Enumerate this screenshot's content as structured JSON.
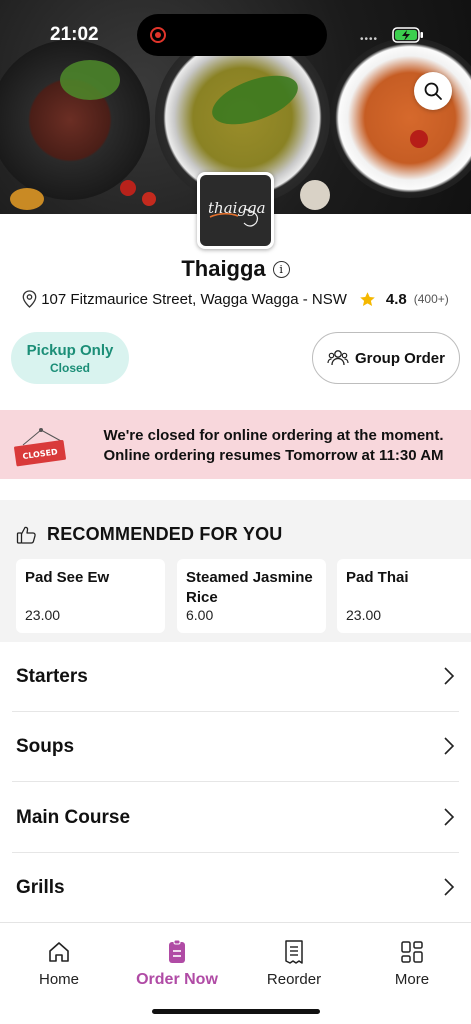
{
  "status_bar": {
    "time": "21:02"
  },
  "restaurant": {
    "name": "Thaigga",
    "logo_text": "thaigga",
    "address": "107 Fitzmaurice Street, Wagga Wagga - NSW",
    "rating": "4.8",
    "rating_count": "(400+)"
  },
  "order_mode": {
    "title": "Pickup Only",
    "status": "Closed"
  },
  "group_order_label": "Group Order",
  "closed_banner": {
    "sign": "CLOSED",
    "line1": "We're closed for online ordering at the moment.",
    "line2": "Online ordering resumes Tomorrow at 11:30 AM"
  },
  "recommended": {
    "title": "RECOMMENDED FOR YOU",
    "items": [
      {
        "name": "Pad See Ew",
        "price": "23.00"
      },
      {
        "name": "Steamed Jasmine Rice",
        "price": "6.00"
      },
      {
        "name": "Pad Thai",
        "price": "23.00"
      }
    ]
  },
  "categories": [
    {
      "label": "Starters"
    },
    {
      "label": "Soups"
    },
    {
      "label": "Main Course"
    },
    {
      "label": "Grills"
    }
  ],
  "bottom_nav": [
    {
      "label": "Home",
      "icon": "home-icon"
    },
    {
      "label": "Order Now",
      "icon": "order-icon"
    },
    {
      "label": "Reorder",
      "icon": "receipt-icon"
    },
    {
      "label": "More",
      "icon": "grid-icon"
    }
  ],
  "colors": {
    "accent": "#b04ba5",
    "pickup_bg": "#d9f3ef",
    "pickup_text": "#1b8e77",
    "banner_bg": "#f8d7dc",
    "closed_sign": "#d93a3a",
    "star": "#f5b800"
  }
}
